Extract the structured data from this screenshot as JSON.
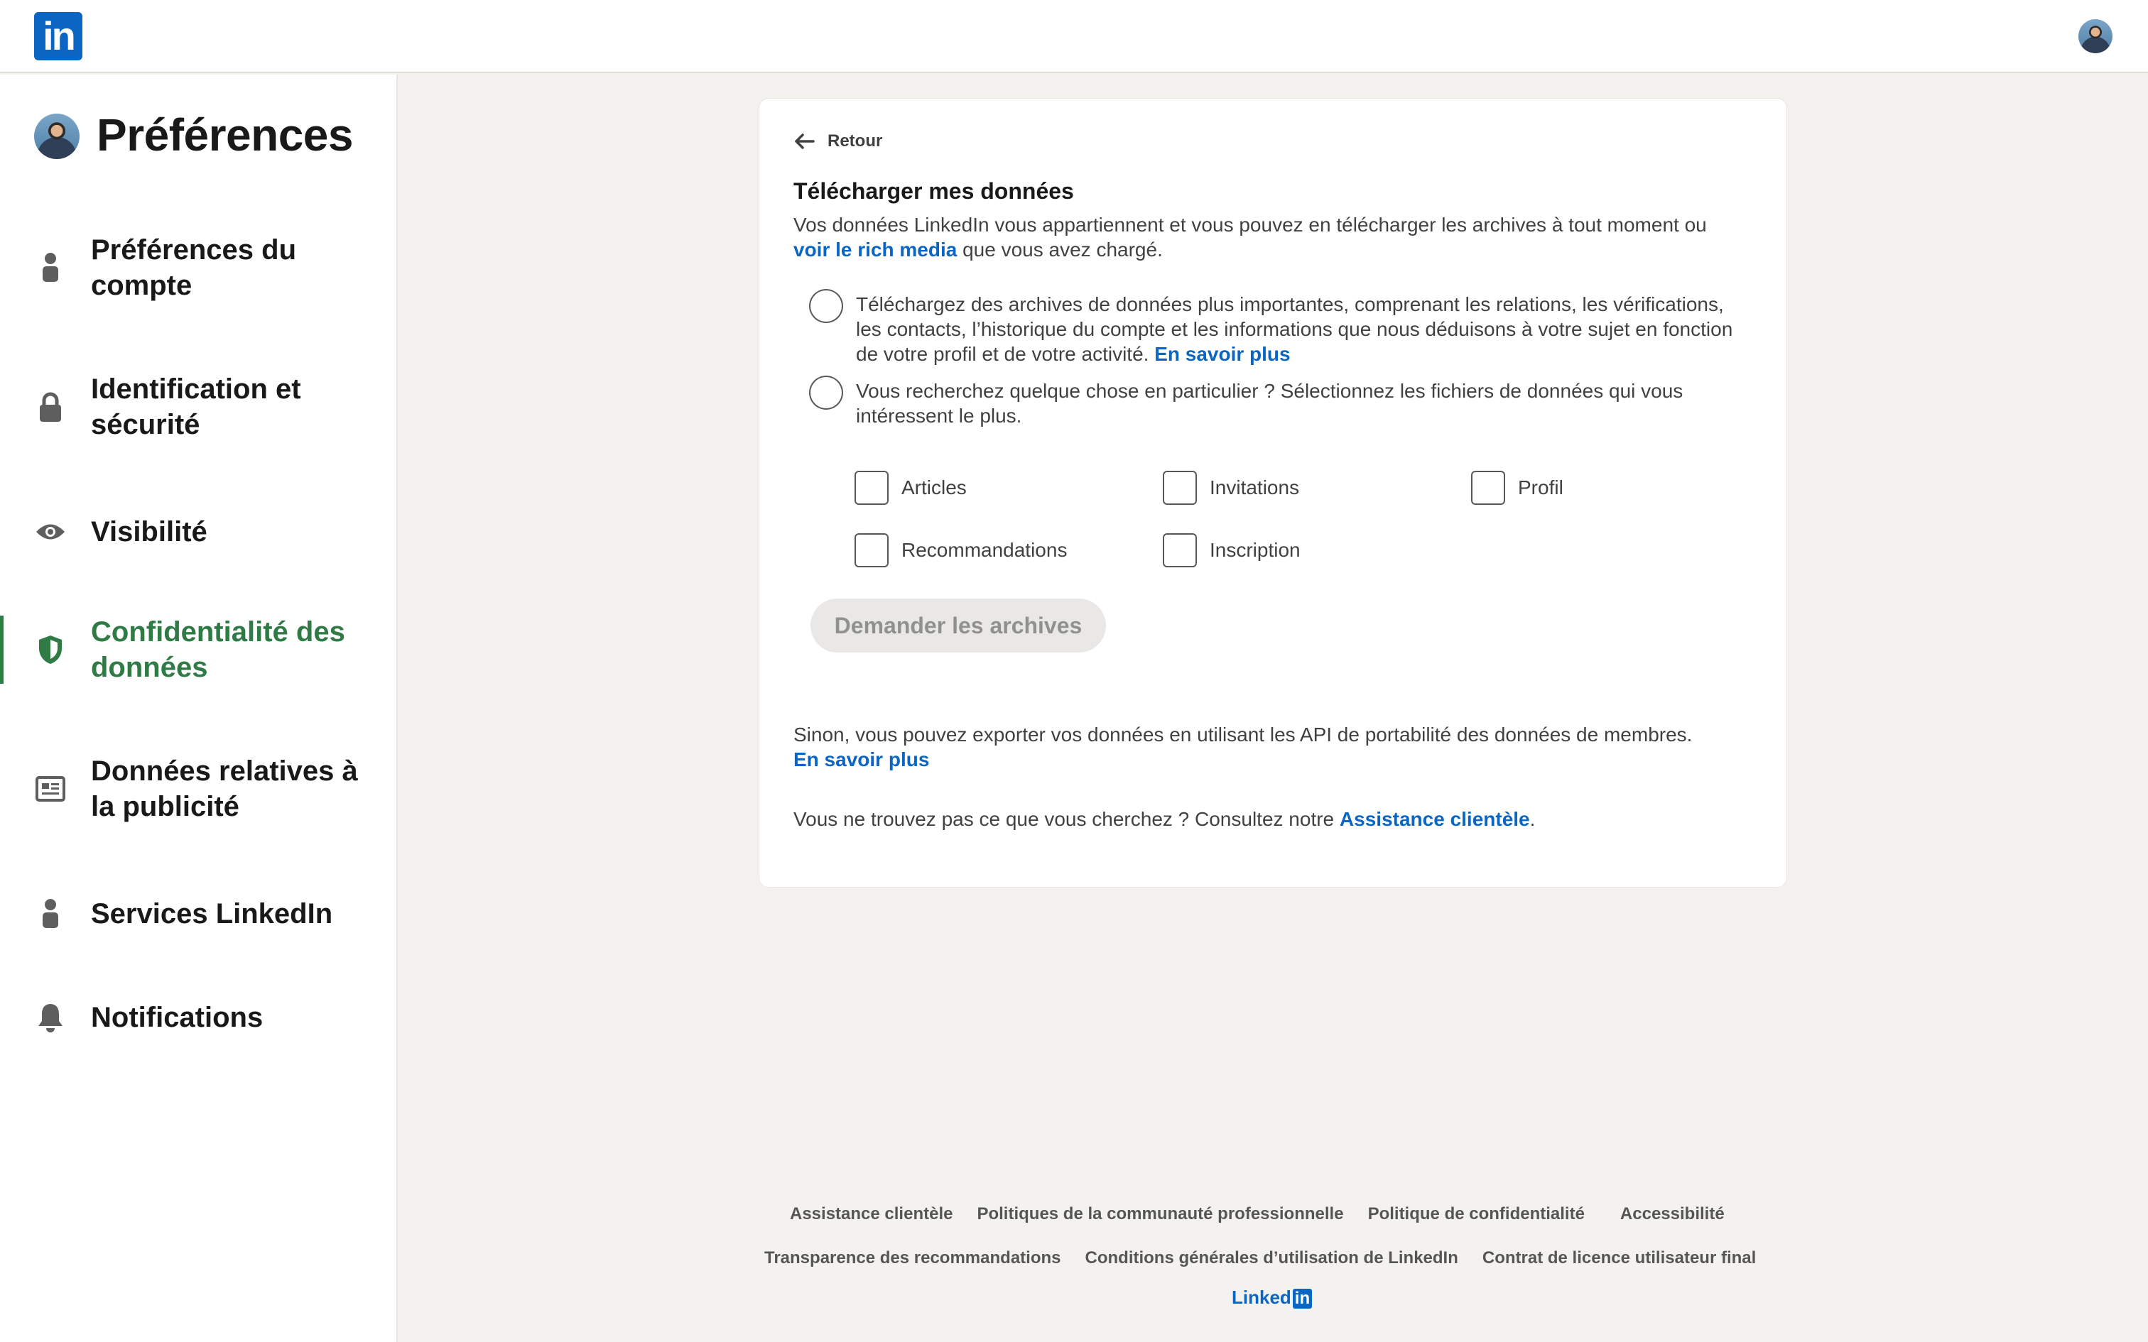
{
  "topbar": {
    "logo_text": "in",
    "avatar": "user-avatar"
  },
  "sidebar": {
    "title": "Préférences",
    "items": [
      {
        "label": "Préférences du compte",
        "icon": "person-icon",
        "active": false
      },
      {
        "label": "Identification et sécurité",
        "icon": "lock-icon",
        "active": false
      },
      {
        "label": "Visibilité",
        "icon": "eye-icon",
        "active": false
      },
      {
        "label": "Confidentialité des données",
        "icon": "shield-icon",
        "active": true
      },
      {
        "label": "Données relatives à la publicité",
        "icon": "newspaper-icon",
        "active": false
      },
      {
        "label": "Services LinkedIn",
        "icon": "person-icon",
        "active": false
      },
      {
        "label": "Notifications",
        "icon": "bell-icon",
        "active": false
      }
    ],
    "active_color": "#2f7a45"
  },
  "card": {
    "back_label": "Retour",
    "title": "Télécharger mes données",
    "intro_text": "Vos données LinkedIn vous appartiennent et vous pouvez en télécharger les archives à tout moment ou",
    "intro_link": "voir le rich media",
    "intro_suffix": " que vous avez chargé.",
    "option1_text": "Téléchargez des archives de données plus importantes, comprenant les relations, les vérifications, les contacts, l’historique du compte et les informations que nous déduisons à votre sujet en fonction de votre profil et de votre activité.",
    "option1_link": "En savoir plus",
    "option2_text": "Vous recherchez quelque chose en particulier ? Sélectionnez les fichiers de données qui vous intéressent le plus.",
    "checkboxes": [
      "Articles",
      "Invitations",
      "Profil",
      "Recommandations",
      "Inscription"
    ],
    "request_button": "Demander les archives",
    "export_text": "Sinon, vous pouvez exporter vos données en utilisant les API de portabilité des données de membres.",
    "export_link": "En savoir plus",
    "help_text": "Vous ne trouvez pas ce que vous cherchez ? Consultez notre",
    "help_link": "Assistance clientèle",
    "help_suffix": "."
  },
  "footer": {
    "row1": [
      "Assistance clientèle",
      "Politiques de la communauté professionnelle",
      "Politique de confidentialité",
      "Accessibilité"
    ],
    "row2": [
      "Transparence des recommandations",
      "Conditions générales d’utilisation de LinkedIn",
      "Contrat de licence utilisateur final"
    ],
    "logo_text": "Linked",
    "logo_in": "in"
  },
  "colors": {
    "link": "#0a66c2",
    "background": "#f3f2ef"
  }
}
